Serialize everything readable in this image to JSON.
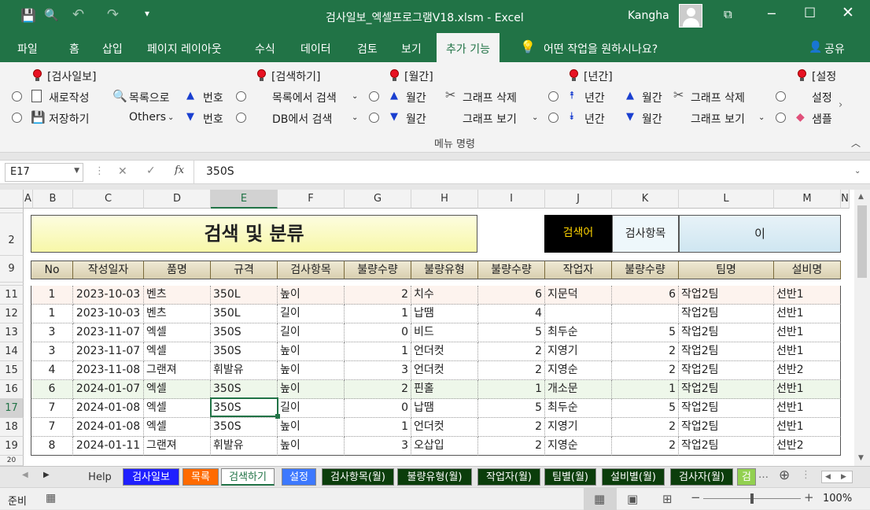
{
  "titlebar": {
    "doc_title": "검사일보_엑셀프로그램V18.xlsm  -  Excel",
    "user": "Kangha"
  },
  "menu": {
    "tabs": [
      "파일",
      "홈",
      "삽입",
      "페이지 레이아웃",
      "수식",
      "데이터",
      "검토",
      "보기",
      "추가 기능"
    ],
    "tell_me": "어떤 작업을 원하시나요?",
    "share": "공유"
  },
  "ribbon": {
    "g1_title": "[검사일보]",
    "new_doc": "새로작성",
    "save": "저장하기",
    "list_to": "목록으로",
    "others": "Others",
    "num_up": "번호",
    "num_down": "번호",
    "g2_title": "[검색하기]",
    "search_list": "목록에서 검색",
    "search_db": "DB에서 검색",
    "g3_title": "[월간]",
    "month_up": "월간",
    "month_down": "월간",
    "graph_del": "그래프 삭제",
    "graph_view": "그래프 보기",
    "g4_title": "[년간]",
    "year_up": "년간",
    "year_down": "년간",
    "month_up2": "월간",
    "month_down2": "월간",
    "graph_del2": "그래프 삭제",
    "graph_view2": "그래프 보기",
    "g5_title": "[설정",
    "settings": "설정",
    "sample": "샘플",
    "group_caption": "메뉴 명령"
  },
  "formula": {
    "name_box": "E17",
    "value": "350S"
  },
  "columns": [
    "A",
    "B",
    "C",
    "D",
    "E",
    "F",
    "G",
    "H",
    "I",
    "J",
    "K",
    "L",
    "M",
    "N"
  ],
  "sheet": {
    "title": "검색 및 분류",
    "search_label": "검색어",
    "search_item_label": "검사항목",
    "search_value": "이",
    "headers": [
      "No",
      "작성일자",
      "품명",
      "규격",
      "검사항목",
      "불량수량",
      "불량유형",
      "불량수량",
      "작업자",
      "불량수량",
      "팀명",
      "설비명"
    ],
    "rows": [
      {
        "r": "11",
        "cells": [
          "1",
          "2023-10-03",
          "벤츠",
          "350L",
          "높이",
          "2",
          "치수",
          "6",
          "지문덕",
          "6",
          "작업2팀",
          "선반1"
        ]
      },
      {
        "r": "12",
        "cells": [
          "1",
          "2023-10-03",
          "벤츠",
          "350L",
          "길이",
          "1",
          "납땜",
          "4",
          "",
          "",
          "작업2팀",
          "선반1"
        ]
      },
      {
        "r": "13",
        "cells": [
          "3",
          "2023-11-07",
          "엑셀",
          "350S",
          "길이",
          "0",
          "비드",
          "5",
          "최두순",
          "5",
          "작업2팀",
          "선반1"
        ]
      },
      {
        "r": "14",
        "cells": [
          "3",
          "2023-11-07",
          "엑셀",
          "350S",
          "높이",
          "1",
          "언더컷",
          "2",
          "지영기",
          "2",
          "작업2팀",
          "선반1"
        ]
      },
      {
        "r": "15",
        "cells": [
          "4",
          "2023-11-08",
          "그랜져",
          "휘발유",
          "높이",
          "3",
          "언더컷",
          "2",
          "지영순",
          "2",
          "작업2팀",
          "선반2"
        ]
      },
      {
        "r": "16",
        "cells": [
          "6",
          "2024-01-07",
          "엑셀",
          "350S",
          "높이",
          "2",
          "핀홀",
          "1",
          "개소문",
          "1",
          "작업2팀",
          "선반1"
        ]
      },
      {
        "r": "17",
        "cells": [
          "7",
          "2024-01-08",
          "엑셀",
          "350S",
          "길이",
          "0",
          "납땜",
          "5",
          "최두순",
          "5",
          "작업2팀",
          "선반1"
        ]
      },
      {
        "r": "18",
        "cells": [
          "7",
          "2024-01-08",
          "엑셀",
          "350S",
          "높이",
          "1",
          "언더컷",
          "2",
          "지영기",
          "2",
          "작업2팀",
          "선반1"
        ]
      },
      {
        "r": "19",
        "cells": [
          "8",
          "2024-01-11",
          "그랜져",
          "휘발유",
          "높이",
          "3",
          "오삽입",
          "2",
          "지영순",
          "2",
          "작업2팀",
          "선반2"
        ]
      }
    ]
  },
  "sheet_tabs": [
    "Help",
    "검사일보",
    "목록",
    "검색하기",
    "설정",
    "검사항목(월)",
    "불량유형(월)",
    "작업자(월)",
    "팀별(월)",
    "설비별(월)",
    "검사자(월)",
    "검"
  ],
  "tab_colors": {
    "검사일보": "#1f1fff",
    "목록": "#ff6a00",
    "설정": "#3c78ff",
    "dark": "#0b3d0b",
    "last": "#92d050"
  },
  "status": {
    "ready": "준비",
    "zoom": "100%"
  }
}
